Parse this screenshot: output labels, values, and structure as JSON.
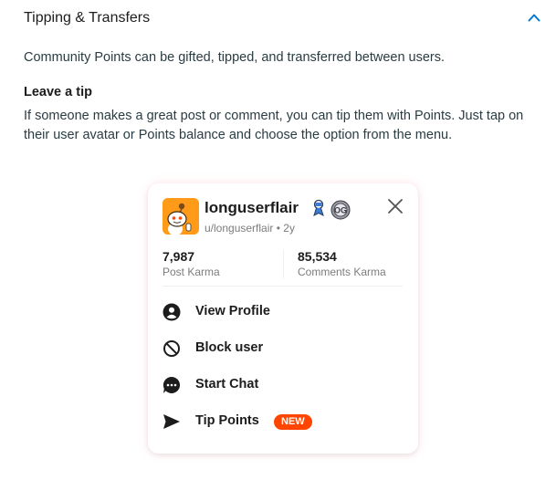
{
  "accordion": {
    "title": "Tipping & Transfers",
    "expanded": true,
    "accent_color": "#0079d3"
  },
  "content": {
    "intro": "Community Points can be gifted, tipped, and transferred between users.",
    "subheading": "Leave a tip",
    "paragraph": "If someone makes a great post or comment, you can tip them with Points. Just tap on their user avatar or Points balance and choose the option from the menu."
  },
  "profile_card": {
    "username": "longuserflair",
    "handle": "u/longuserflair",
    "separator": "•",
    "account_age": "2y",
    "badges": [
      "trophy-badge-icon",
      "og-badge-icon"
    ],
    "badge_text": "OG",
    "stats": [
      {
        "value": "7,987",
        "label": "Post Karma"
      },
      {
        "value": "85,534",
        "label": "Comments Karma"
      }
    ],
    "menu": [
      {
        "label": "View Profile",
        "icon": "profile-icon"
      },
      {
        "label": "Block user",
        "icon": "block-icon"
      },
      {
        "label": "Start Chat",
        "icon": "chat-icon"
      },
      {
        "label": "Tip Points",
        "icon": "send-icon",
        "badge": "NEW"
      }
    ],
    "badge_color": "#ff4500"
  }
}
